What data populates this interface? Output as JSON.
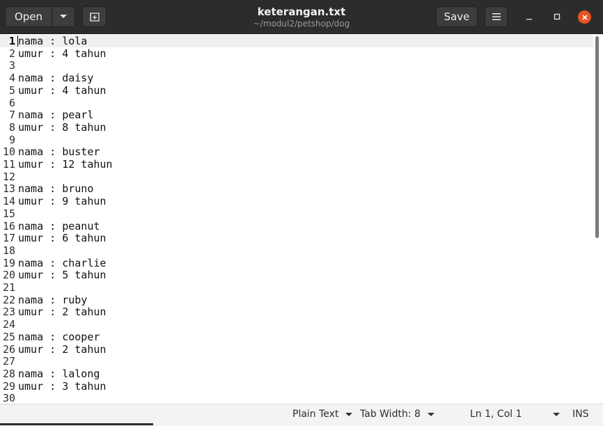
{
  "header": {
    "open_label": "Open",
    "save_label": "Save",
    "title": "keterangan.txt",
    "subtitle": "~/modul2/petshop/dog"
  },
  "icons": {
    "open_dropdown": "chevron-down-icon",
    "new_tab": "new-tab-icon",
    "menu": "hamburger-menu-icon",
    "minimize": "minimize-icon",
    "maximize": "maximize-icon",
    "close": "close-icon"
  },
  "colors": {
    "titlebar": "#2c2c2c",
    "close_button": "#e95420",
    "current_line": "#f0f0f0"
  },
  "editor": {
    "lines": [
      {
        "n": "1",
        "t": "nama : lola"
      },
      {
        "n": "2",
        "t": "umur : 4 tahun"
      },
      {
        "n": "3",
        "t": ""
      },
      {
        "n": "4",
        "t": "nama : daisy"
      },
      {
        "n": "5",
        "t": "umur : 4 tahun"
      },
      {
        "n": "6",
        "t": ""
      },
      {
        "n": "7",
        "t": "nama : pearl"
      },
      {
        "n": "8",
        "t": "umur : 8 tahun"
      },
      {
        "n": "9",
        "t": ""
      },
      {
        "n": "10",
        "t": "nama : buster"
      },
      {
        "n": "11",
        "t": "umur : 12 tahun"
      },
      {
        "n": "12",
        "t": ""
      },
      {
        "n": "13",
        "t": "nama : bruno"
      },
      {
        "n": "14",
        "t": "umur : 9 tahun"
      },
      {
        "n": "15",
        "t": ""
      },
      {
        "n": "16",
        "t": "nama : peanut"
      },
      {
        "n": "17",
        "t": "umur : 6 tahun"
      },
      {
        "n": "18",
        "t": ""
      },
      {
        "n": "19",
        "t": "nama : charlie"
      },
      {
        "n": "20",
        "t": "umur : 5 tahun"
      },
      {
        "n": "21",
        "t": ""
      },
      {
        "n": "22",
        "t": "nama : ruby"
      },
      {
        "n": "23",
        "t": "umur : 2 tahun"
      },
      {
        "n": "24",
        "t": ""
      },
      {
        "n": "25",
        "t": "nama : cooper"
      },
      {
        "n": "26",
        "t": "umur : 2 tahun"
      },
      {
        "n": "27",
        "t": ""
      },
      {
        "n": "28",
        "t": "nama : lalong"
      },
      {
        "n": "29",
        "t": "umur : 3 tahun"
      },
      {
        "n": "30",
        "t": ""
      }
    ]
  },
  "status": {
    "language": "Plain Text",
    "tab_width": "Tab Width: 8",
    "position": "Ln 1, Col 1",
    "mode": "INS"
  }
}
